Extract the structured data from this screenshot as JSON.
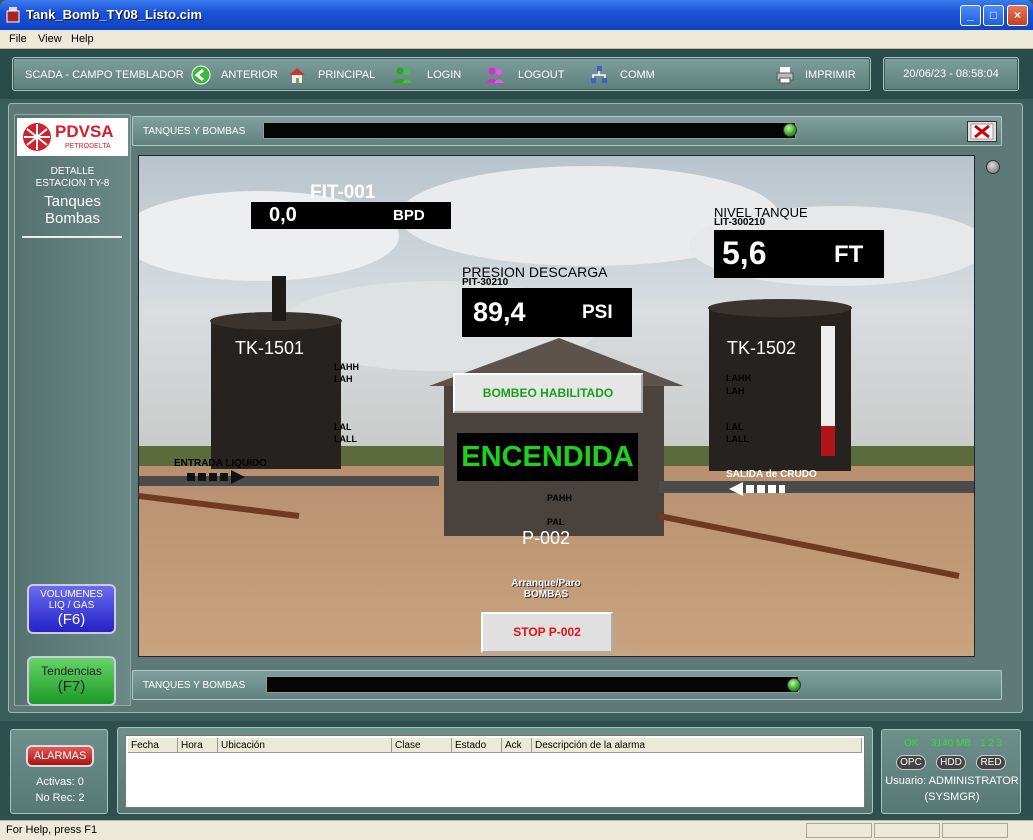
{
  "window": {
    "title": "Tank_Bomb_TY08_Listo.cim",
    "min": "_",
    "max": "□",
    "close": "×"
  },
  "menu": {
    "file": "File",
    "view": "View",
    "help": "Help"
  },
  "toolbar": {
    "site": "SCADA - CAMPO TEMBLADOR",
    "anterior": "ANTERIOR",
    "principal": "PRINCIPAL",
    "login": "LOGIN",
    "logout": "LOGOUT",
    "comm": "COMM",
    "imprimir": "IMPRIMIR",
    "datetime": "20/06/23 - 08:58:04"
  },
  "sidebar": {
    "logo_text": "PDVSA",
    "logo_sub": "PETRODELTA",
    "detalle": "DETALLE",
    "estacion": "ESTACION TY-8",
    "page_line1": "Tanques",
    "page_line2": "Bombas",
    "vol_line1": "VOLUMENES",
    "vol_line2": "LIQ / GAS",
    "vol_key": "(F6)",
    "tend_line1": "Tendencias",
    "tend_key": "(F7)"
  },
  "strip": {
    "top_label": "TANQUES Y BOMBAS",
    "bottom_label": "TANQUES Y BOMBAS"
  },
  "scene": {
    "fit_tag": "FIT-001",
    "fit_value": "0,0",
    "fit_unit": "BPD",
    "press_title": "PRESION DESCARGA",
    "press_tag": "PIT-30210",
    "press_value": "89,4",
    "press_unit": "PSI",
    "level_title": "NIVEL TANQUE",
    "level_tag": "LIT-300210",
    "level_value": "5,6",
    "level_unit": "FT",
    "tank1": "TK-1501",
    "tank2": "TK-1502",
    "pump": "P-002",
    "bombeo": "BOMBEO HABILITADO",
    "status": "ENCENDIDA",
    "entrada": "ENTRADA LIQUIDO",
    "salida": "SALIDA de CRUDO",
    "arranque_line1": "Arranque/Paro",
    "arranque_line2": "BOMBAS",
    "stop_button": "STOP P-002",
    "lahh": "LAHH",
    "lah": "LAH",
    "lal": "LAL",
    "lall": "LALL",
    "pahh": "PAHH",
    "pal": "PAL"
  },
  "alarms": {
    "button": "ALARMAS",
    "activas": "Activas: 0",
    "norec": "No Rec: 2",
    "columns": [
      "Fecha",
      "Hora",
      "Ubicación",
      "Clase",
      "Estado",
      "Ack",
      "Descripción de la alarma"
    ]
  },
  "system": {
    "ok": "OK",
    "mem": "3140 MB",
    "nums": "1  2  3",
    "opc": "OPC",
    "hdd": "HDD",
    "red": "RED",
    "user": "Usuario: ADMINISTRATOR",
    "group": "(SYSMGR)"
  },
  "status": {
    "help": "For Help, press F1"
  }
}
